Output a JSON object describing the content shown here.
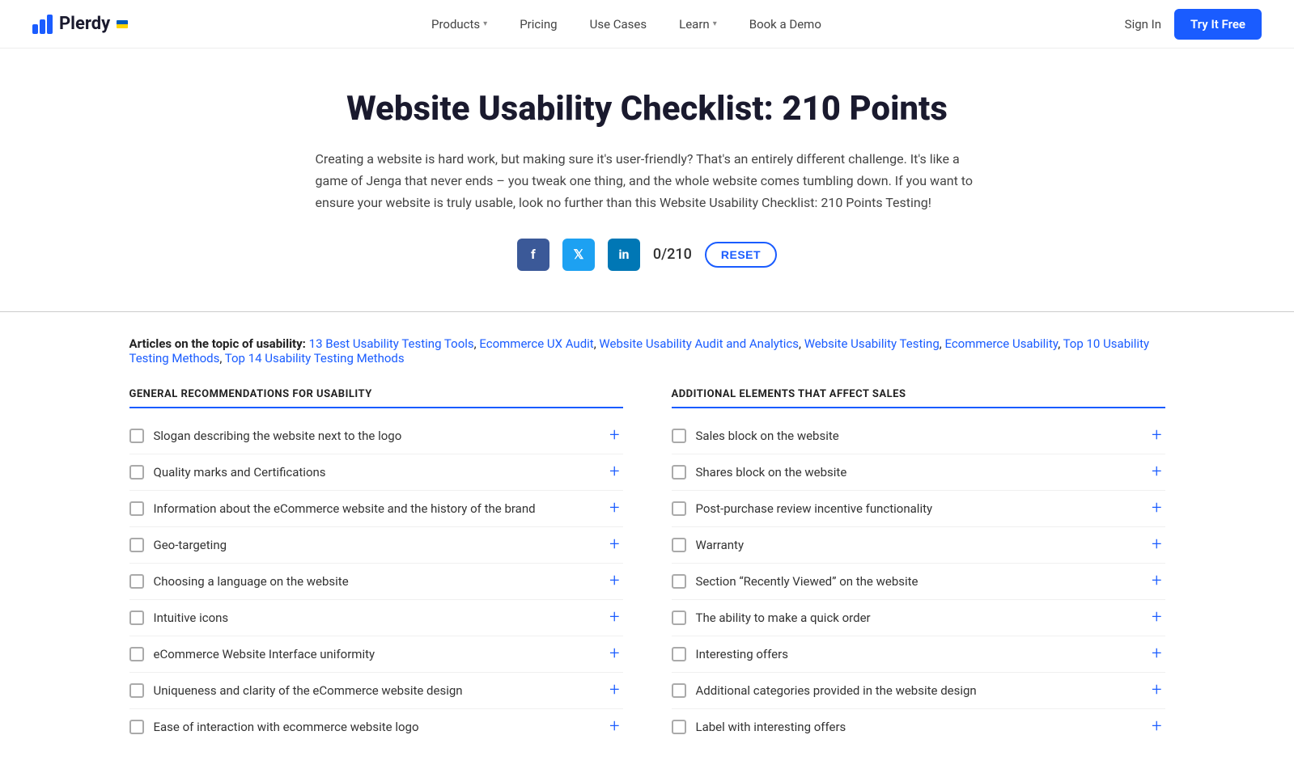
{
  "nav": {
    "logo_text": "Plerdy",
    "items": [
      {
        "label": "Products",
        "has_dropdown": true
      },
      {
        "label": "Pricing",
        "has_dropdown": false
      },
      {
        "label": "Use Cases",
        "has_dropdown": false
      },
      {
        "label": "Learn",
        "has_dropdown": true
      },
      {
        "label": "Book a Demo",
        "has_dropdown": false
      }
    ],
    "signin_label": "Sign In",
    "try_label": "Try It Free"
  },
  "hero": {
    "title": "Website Usability Checklist: 210 Points",
    "description": "Creating a website is hard work, but making sure it's user-friendly? That's an entirely different challenge. It's like a game of Jenga that never ends – you tweak one thing, and the whole website comes tumbling down. If you want to ensure your website is truly usable, look no further than this Website Usability Checklist: 210 Points Testing!",
    "counter": "0/210",
    "reset_label": "RESET"
  },
  "articles": {
    "prefix": "Articles on the topic of usability:",
    "links": [
      "13 Best Usability Testing Tools",
      "Ecommerce UX Audit",
      "Website Usability Audit and Analytics",
      "Website Usability Testing",
      "Ecommerce Usability",
      "Top 10 Usability Testing Methods",
      "Top 14 Usability Testing Methods"
    ]
  },
  "left_section": {
    "title": "GENERAL RECOMMENDATIONS FOR USABILITY",
    "items": [
      "Slogan describing the website next to the logo",
      "Quality marks and Certifications",
      "Information about the eCommerce website and the history of the brand",
      "Geo-targeting",
      "Choosing a language on the website",
      "Intuitive icons",
      "eCommerce Website Interface uniformity",
      "Uniqueness and clarity of the eCommerce website design",
      "Ease of interaction with ecommerce website logo"
    ]
  },
  "right_section": {
    "title": "ADDITIONAL ELEMENTS THAT AFFECT SALES",
    "items": [
      "Sales block on the website",
      "Shares block on the website",
      "Post-purchase review incentive functionality",
      "Warranty",
      "Section “Recently Viewed” on the website",
      "The ability to make a quick order",
      "Interesting offers",
      "Additional categories provided in the website design",
      "Label with interesting offers"
    ]
  }
}
